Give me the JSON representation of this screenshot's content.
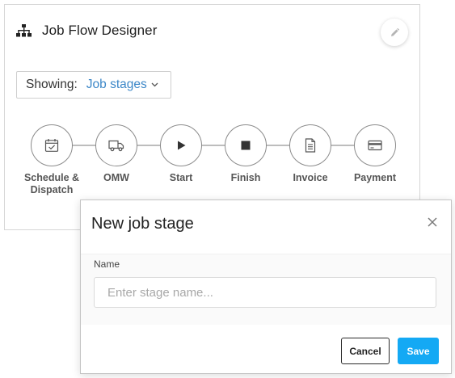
{
  "designer": {
    "title": "Job Flow Designer",
    "icon": "sitemap-icon",
    "edit_icon": "pencil-icon"
  },
  "filter": {
    "label": "Showing:",
    "value": "Job stages"
  },
  "stages": [
    {
      "label": "Schedule & Dispatch",
      "icon": "calendar-check-icon"
    },
    {
      "label": "OMW",
      "icon": "truck-icon"
    },
    {
      "label": "Start",
      "icon": "play-icon"
    },
    {
      "label": "Finish",
      "icon": "stop-icon"
    },
    {
      "label": "Invoice",
      "icon": "document-icon"
    },
    {
      "label": "Payment",
      "icon": "credit-card-icon"
    }
  ],
  "modal": {
    "title": "New job stage",
    "name_label": "Name",
    "name_placeholder": "Enter stage name...",
    "name_value": "",
    "cancel_label": "Cancel",
    "save_label": "Save"
  },
  "colors": {
    "accent": "#14a9f4",
    "link": "#3c87c8",
    "stage_border": "#8b8b8b"
  }
}
